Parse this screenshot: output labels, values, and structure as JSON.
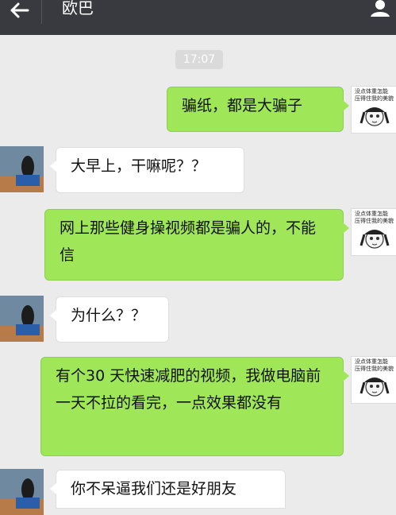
{
  "header": {
    "title": "欧巴"
  },
  "timestamp": "17:07",
  "me_avatar_caption": [
    "没点体重怎能",
    "压得住我的美貌"
  ],
  "messages": [
    {
      "side": "me",
      "text": "骗纸，都是大骗子"
    },
    {
      "side": "friend",
      "text": "大早上，干嘛呢？？"
    },
    {
      "side": "me",
      "text": "网上那些健身操视频都是骗人的，不能信"
    },
    {
      "side": "friend",
      "text": "为什么？？"
    },
    {
      "side": "me",
      "text": "有个30 天快速减肥的视频，我做电脑前一天不拉的看完，一点效果都没有"
    },
    {
      "side": "friend",
      "text": "你不呆逼我们还是好朋友"
    }
  ]
}
